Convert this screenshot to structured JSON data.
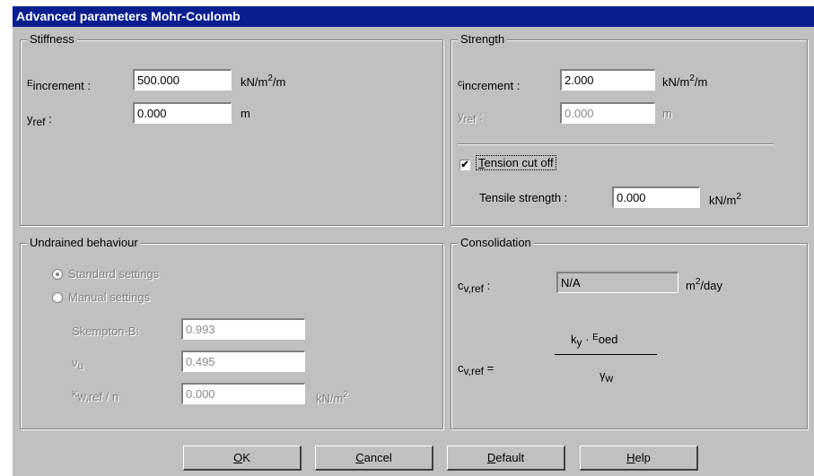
{
  "window": {
    "title": "Advanced parameters Mohr-Coulomb"
  },
  "stiffness": {
    "legend": "Stiffness",
    "e_increment": {
      "symbol": "E",
      "subscript": "increment",
      "colon": ":",
      "value": "500.000",
      "unit_pre": "kN/m",
      "unit_sup": "2",
      "unit_post": "/m"
    },
    "y_ref": {
      "symbol": "y",
      "subscript": "ref",
      "colon": ":",
      "value": "0.000",
      "unit": "m"
    }
  },
  "strength": {
    "legend": "Strength",
    "c_increment": {
      "symbol": "c",
      "subscript": "increment",
      "colon": ":",
      "value": "2.000",
      "unit_pre": "kN/m",
      "unit_sup": "2",
      "unit_post": "/m"
    },
    "y_ref": {
      "symbol": "y",
      "subscript": "ref",
      "colon": ":",
      "value": "0.000",
      "unit": "m"
    },
    "tension_cut_off": {
      "label": "Tension cut off",
      "mnemonic": "T",
      "rest": "ension cut off",
      "checked": true,
      "check_glyph": "✔"
    },
    "tensile_strength": {
      "label": "Tensile strength :",
      "value": "0.000",
      "unit_pre": "kN/m",
      "unit_sup": "2"
    }
  },
  "undrained": {
    "legend": "Undrained behaviour",
    "standard": {
      "label": "Standard settings",
      "selected": true
    },
    "manual": {
      "label": "Manual settings",
      "selected": false
    },
    "skempton": {
      "label": "Skempton-B:",
      "value": "0.993"
    },
    "nu_u": {
      "symbol": "ν",
      "subscript": "u",
      "value": "0.495"
    },
    "k_w_ref": {
      "symbol": "K",
      "subscript": "w,ref",
      "suffix": " / n",
      "value": "0.000",
      "unit_pre": "kN/m",
      "unit_sup": "2"
    }
  },
  "consolidation": {
    "legend": "Consolidation",
    "cv_ref": {
      "symbol": "c",
      "subscript": "v,ref",
      "colon": ":",
      "value": "N/A",
      "unit_pre": "m",
      "unit_sup": "2",
      "unit_post": "/day"
    },
    "formula": {
      "lhs_symbol": "c",
      "lhs_subscript": "v,ref",
      "equals": "=",
      "num_k": "k",
      "num_k_sub": "y",
      "num_dot": "·",
      "num_e": "E",
      "num_e_sub": "oed",
      "den_symbol": "γ",
      "den_sub": "w"
    }
  },
  "buttons": {
    "ok": {
      "mnemonic": "O",
      "rest": "K"
    },
    "cancel": {
      "mnemonic": "C",
      "rest": "ancel"
    },
    "default": {
      "mnemonic": "D",
      "rest": "efault"
    },
    "help": {
      "mnemonic": "H",
      "rest": "elp"
    }
  }
}
